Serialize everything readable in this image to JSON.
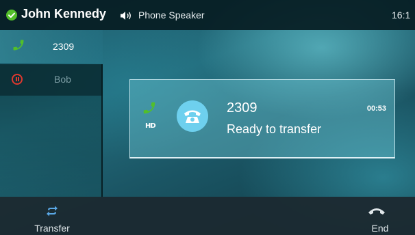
{
  "status_bar": {
    "user_name": "John Kennedy",
    "audio_mode": "Phone Speaker",
    "time": "16:1",
    "status_icon": "check-icon",
    "audio_icon": "speaker-icon"
  },
  "call_list": [
    {
      "label": "2309",
      "state": "active",
      "icon": "phone-icon"
    },
    {
      "label": "Bob",
      "state": "hold",
      "icon": "hold-icon"
    }
  ],
  "active_call": {
    "number": "2309",
    "status": "Ready to transfer",
    "duration": "00:53",
    "badge": "HD",
    "avatar_icon": "phone-avatar-icon"
  },
  "softkeys": {
    "transfer_label": "Transfer",
    "end_label": "End"
  },
  "colors": {
    "green": "#52bf2a",
    "hold_red": "#e0382e",
    "avatar_blue": "#6ed0ee"
  }
}
